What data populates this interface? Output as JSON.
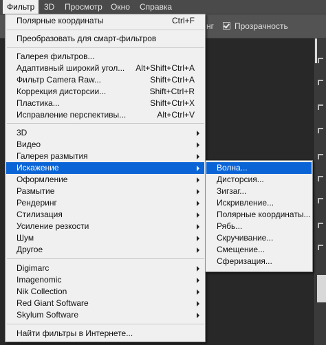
{
  "menubar": {
    "items": [
      "Фильтр",
      "3D",
      "Просмотр",
      "Окно",
      "Справка"
    ]
  },
  "options": {
    "fragment": "нг",
    "transparency_label": "Прозрачность",
    "transparency_checked": true
  },
  "menu": {
    "items": [
      {
        "label": "Полярные координаты",
        "shortcut": "Ctrl+F"
      },
      {
        "label": "Преобразовать для смарт-фильтров",
        "shortcut": ""
      },
      {
        "label": "Галерея фильтров...",
        "shortcut": ""
      },
      {
        "label": "Адаптивный широкий угол...",
        "shortcut": "Alt+Shift+Ctrl+A"
      },
      {
        "label": "Фильтр Camera Raw...",
        "shortcut": "Shift+Ctrl+A"
      },
      {
        "label": "Коррекция дисторсии...",
        "shortcut": "Shift+Ctrl+R"
      },
      {
        "label": "Пластика...",
        "shortcut": "Shift+Ctrl+X"
      },
      {
        "label": "Исправление перспективы...",
        "shortcut": "Alt+Ctrl+V"
      },
      {
        "label": "3D",
        "shortcut": ""
      },
      {
        "label": "Видео",
        "shortcut": ""
      },
      {
        "label": "Галерея размытия",
        "shortcut": ""
      },
      {
        "label": "Искажение",
        "shortcut": ""
      },
      {
        "label": "Оформление",
        "shortcut": ""
      },
      {
        "label": "Размытие",
        "shortcut": ""
      },
      {
        "label": "Рендеринг",
        "shortcut": ""
      },
      {
        "label": "Стилизация",
        "shortcut": ""
      },
      {
        "label": "Усиление резкости",
        "shortcut": ""
      },
      {
        "label": "Шум",
        "shortcut": ""
      },
      {
        "label": "Другое",
        "shortcut": ""
      },
      {
        "label": "Digimarc",
        "shortcut": ""
      },
      {
        "label": "Imagenomic",
        "shortcut": ""
      },
      {
        "label": "Nik Collection",
        "shortcut": ""
      },
      {
        "label": "Red Giant Software",
        "shortcut": ""
      },
      {
        "label": "Skylum Software",
        "shortcut": ""
      },
      {
        "label": "Найти фильтры в Интернете...",
        "shortcut": ""
      }
    ]
  },
  "submenu": {
    "items": [
      "Волна...",
      "Дисторсия...",
      "Зигзаг...",
      "Искривление...",
      "Полярные координаты...",
      "Рябь...",
      "Скручивание...",
      "Смещение...",
      "Сферизация..."
    ]
  },
  "colors": {
    "highlight": "#0a64d6",
    "menu_bg": "#f0f0f0",
    "menubar_bg": "#4a4a4a"
  }
}
